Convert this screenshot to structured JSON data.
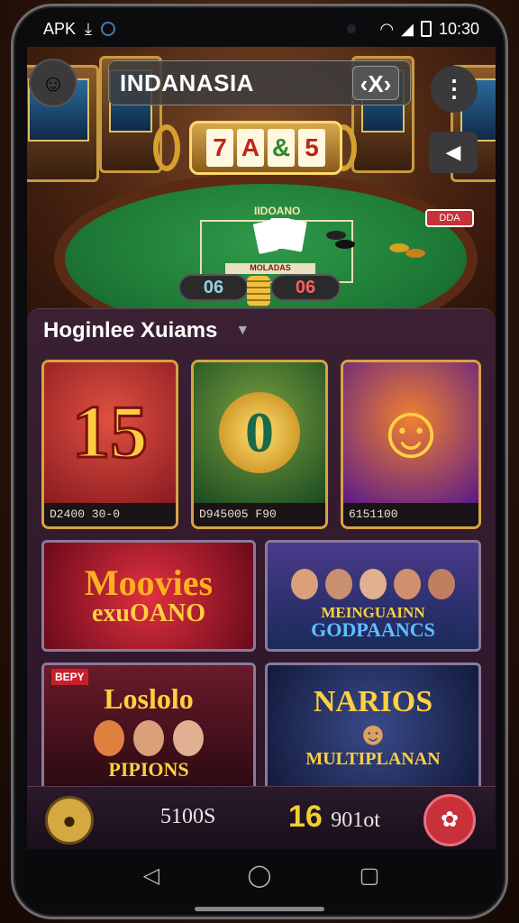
{
  "statusbar": {
    "left_label": "APK",
    "time": "10:30"
  },
  "header": {
    "title": "INDANASIA",
    "close_label": "‹X›",
    "menu_label": "⋮"
  },
  "hero": {
    "reels": [
      "7",
      "A",
      "&",
      "5"
    ],
    "table_label": "IIDOANO",
    "table_strip": "MOLADAS",
    "counter_left": "06",
    "counter_right": "06",
    "sign_label": "DDA"
  },
  "panel": {
    "title": "Hoginlee Xuiams",
    "tiles": [
      {
        "art_text": "15",
        "caption": "D2400 30-0"
      },
      {
        "art_text": "0",
        "caption": "D945005  F90"
      },
      {
        "art_text": "☺",
        "caption": "6151100"
      }
    ],
    "banners": [
      {
        "line1": "Moovies",
        "line2": "exuOANO"
      },
      {
        "line1": "MEINGUAINN",
        "line2": "GODPAANCS"
      },
      {
        "badge": "BEPY",
        "line1": "Loslolo",
        "line2": "PIPIONS"
      },
      {
        "line1": "NARIOS",
        "line2": "MULTIPLANAN"
      }
    ]
  },
  "bottombar": {
    "text1": "5100S",
    "text2_number": "16",
    "text2_rest": "901ot"
  },
  "navbar": {
    "back": "◁",
    "home": "◯",
    "recents": "▢"
  }
}
